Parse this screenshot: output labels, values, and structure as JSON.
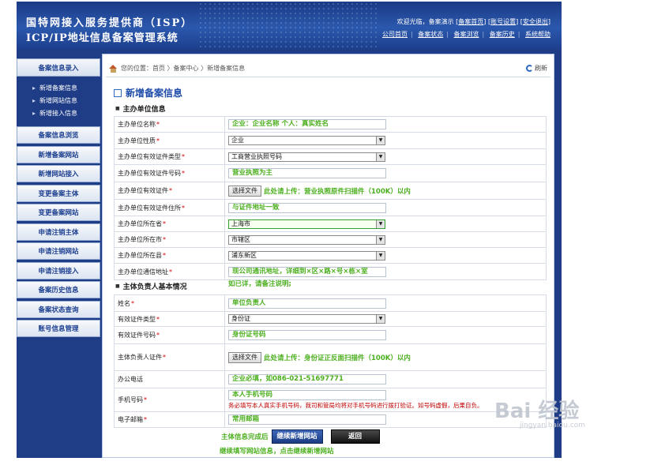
{
  "header": {
    "brand_line1": "国特网接入服务提供商（ISP）",
    "brand_line2": "ICP/IP地址信息备案管理系统",
    "welcome": "欢迎光临，备案演示",
    "top_links": [
      "备案首页",
      "账号设置",
      "安全退出"
    ],
    "nav_links": [
      "公司首页",
      "备案状态",
      "备案浏览",
      "备案历史",
      "系统帮助"
    ]
  },
  "sidebar": {
    "head": "备案信息录入",
    "sub_items": [
      "新增备案信息",
      "新增网站信息",
      "新增接入信息"
    ],
    "items": [
      "备案信息浏览",
      "新增备案网站",
      "新增网站接入",
      "变更备案主体",
      "变更备案网站",
      "申请注销主体",
      "申请注销网站",
      "申请注销接入",
      "备案历史信息",
      "备案状态查询",
      "账号信息管理"
    ]
  },
  "main": {
    "breadcrumb": "您的位置：首页 〉备案中心 〉新增备案信息",
    "refresh": "刷新",
    "title": "新增备案信息",
    "section1": "主办单位信息",
    "section2": "主体负责人基本情况",
    "required_mark": "*",
    "rows1": {
      "name": {
        "label": "主办单位名称",
        "value": "企业：企业名称  个人：真实姓名"
      },
      "nature": {
        "label": "主办单位性质",
        "value": "企业"
      },
      "cert_type": {
        "label": "主办单位有效证件类型",
        "value": "工商营业执照号码"
      },
      "cert_no": {
        "label": "主办单位有效证件号码",
        "value": "营业执照为主"
      },
      "cert_file": {
        "label": "主办单位有效证件",
        "button": "选择文件",
        "hint": "此处请上传：营业执照原件扫描件（100K）以内"
      },
      "cert_addr": {
        "label": "主办单位有效证件住所",
        "value": "与证件地址一致"
      },
      "province": {
        "label": "主办单位所在省",
        "value": "上海市"
      },
      "city": {
        "label": "主办单位所在市",
        "value": "市辖区"
      },
      "county": {
        "label": "主办单位所在县",
        "value": "浦东新区"
      },
      "address": {
        "label": "主办单位通信地址",
        "value": "现公司通讯地址，详细到×区×路×号×栋×室",
        "note": "如已详，请备注说明;"
      }
    },
    "rows2": {
      "name": {
        "label": "姓名",
        "value": "单位负责人"
      },
      "cert_type": {
        "label": "有效证件类型",
        "value": "身份证"
      },
      "cert_no": {
        "label": "有效证件号码",
        "value": "身份证号码"
      },
      "cert_file": {
        "label": "主体负责人证件",
        "button": "选择文件",
        "hint": "此处请上传：身份证正反面扫描件（100K）以内"
      },
      "phone": {
        "label": "办公电话",
        "value": "企业必填，如086-021-51697771"
      },
      "mobile": {
        "label": "手机号码",
        "value": "本人手机号码",
        "warning": "务必填写本人真实手机号码，我司和管局均将对手机号码进行拨打验证。如号码虚假，后果自负。"
      },
      "email": {
        "label": "电子邮箱",
        "value": "常用邮箱"
      }
    },
    "actions": {
      "prefix": "主体信息完成后",
      "continue_button": "继续新增网站",
      "back_button": "返回",
      "note": "继续填写网站信息，点击继续新增网站"
    }
  },
  "watermark": {
    "text": "Bai 经验",
    "sub": "jingyan.baidu.com"
  }
}
